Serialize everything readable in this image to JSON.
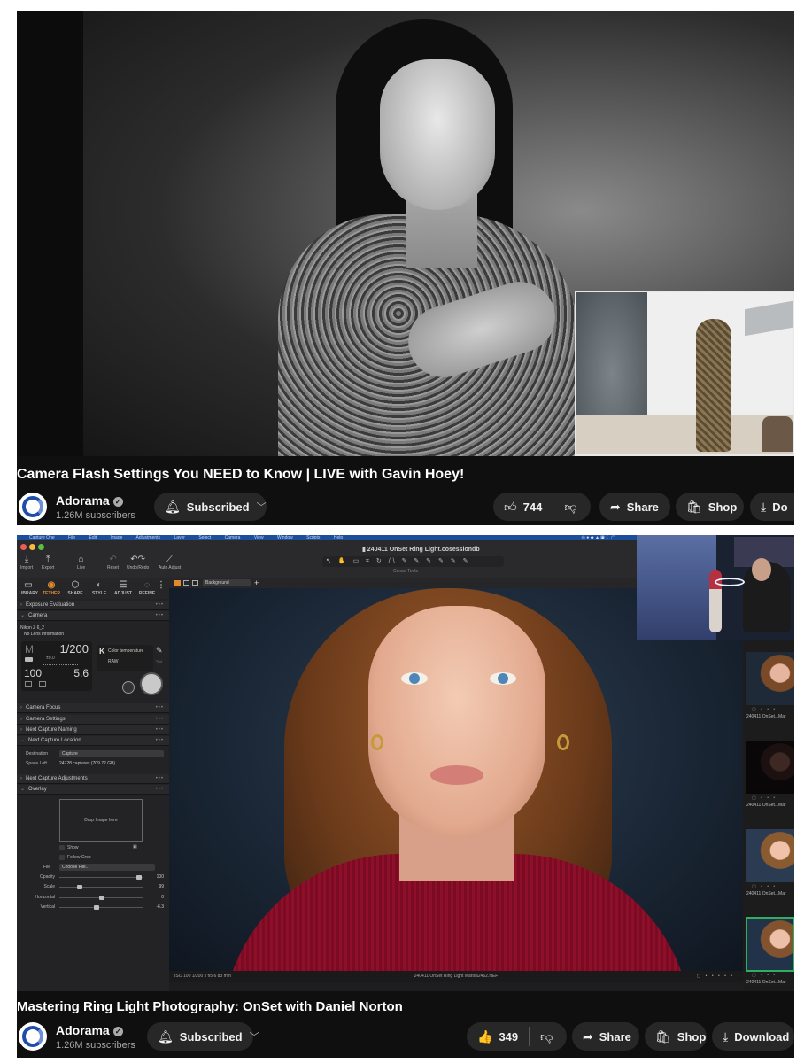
{
  "videos": [
    {
      "title": "Camera Flash Settings You NEED to Know | LIVE with Gavin Hoey!",
      "channel": {
        "name": "Adorama",
        "verified": true,
        "subscribers": "1.26M subscribers"
      },
      "subscribe_label": "Subscribed",
      "likes": "744",
      "actions": {
        "share": "Share",
        "shop": "Shop",
        "download": "Do"
      },
      "icons": {
        "bell": "bell-icon",
        "like": "thumbs-up-icon",
        "dislike": "thumbs-down-icon",
        "share": "share-arrow-icon",
        "shop": "shopping-bag-icon",
        "download": "download-icon"
      }
    },
    {
      "title": "Mastering Ring Light Photography: OnSet with Daniel Norton",
      "channel": {
        "name": "Adorama",
        "verified": true,
        "subscribers": "1.26M subscribers"
      },
      "subscribe_label": "Subscribed",
      "likes": "349",
      "actions": {
        "share": "Share",
        "shop": "Shop",
        "download": "Download"
      },
      "icons": {
        "bell": "bell-icon",
        "like": "thumbs-up-filled-icon",
        "dislike": "thumbs-down-icon",
        "share": "share-arrow-icon",
        "shop": "shopping-bag-icon",
        "download": "download-icon"
      }
    }
  ],
  "capture_one": {
    "menubar": [
      "Capture One",
      "File",
      "Edit",
      "Image",
      "Adjustments",
      "Layer",
      "Select",
      "Camera",
      "View",
      "Window",
      "Scripts",
      "Help"
    ],
    "document_title": "240411 OnSet Ring Light.cosessiondb",
    "toolbar": {
      "import": "Import",
      "export": "Export",
      "live": "Live",
      "reset": "Reset",
      "undo_redo": "Undo/Redo",
      "auto_adjust": "Auto Adjust",
      "cursor_tools": "Cursor Tools"
    },
    "tool_tabs": [
      "LIBRARY",
      "TETHER",
      "SHAPE",
      "STYLE",
      "ADJUST",
      "REFINE"
    ],
    "active_tab": "TETHER",
    "viewer_background": "Background",
    "sections": {
      "exposure_evaluation": "Exposure Evaluation",
      "camera": "Camera",
      "camera_focus": "Camera Focus",
      "camera_settings": "Camera Settings",
      "next_capture_naming": "Next Capture Naming",
      "next_capture_location": "Next Capture Location",
      "next_capture_adjustments": "Next Capture Adjustments",
      "overlay": "Overlay"
    },
    "camera": {
      "model": "Nikon Z 6_2",
      "lens": "No Lens Information",
      "mode": "M",
      "shutter": "1/200",
      "exposure_comp": "±0.0",
      "iso": "100",
      "aperture": "5.6",
      "wb_label": "Color temperature",
      "format": "RAW",
      "set_label": "Set"
    },
    "location": {
      "destination_label": "Destination",
      "destination_value": "Capture",
      "space_left_label": "Space Left",
      "space_left_value": "24728 captures (709.72 GB)"
    },
    "overlay": {
      "drop_label": "Drop Image here",
      "show_label": "Show",
      "follow_crop_label": "Follow Crop",
      "file_label": "File",
      "file_value": "Choose File...",
      "sliders": [
        {
          "label": "Opacity",
          "value": "100",
          "fraction": 0.98
        },
        {
          "label": "Scale",
          "value": "99",
          "fraction": 0.22
        },
        {
          "label": "Horizontal",
          "value": "0",
          "fraction": 0.5
        },
        {
          "label": "Vertical",
          "value": "-6.3",
          "fraction": 0.44
        }
      ]
    },
    "status": {
      "meta": "ISO 100   1/200 s   f/5.6   83 mm",
      "filename": "240411 OnSet Ring Light Marisa2462.NEF"
    },
    "thumbnails": [
      {
        "caption": "240411 OnSet...Mar"
      },
      {
        "caption": "240411 OnSet...Mar"
      },
      {
        "caption": "240411 OnSet...Mar"
      },
      {
        "caption": "240411 OnSet...Mar",
        "selected": true
      }
    ]
  }
}
